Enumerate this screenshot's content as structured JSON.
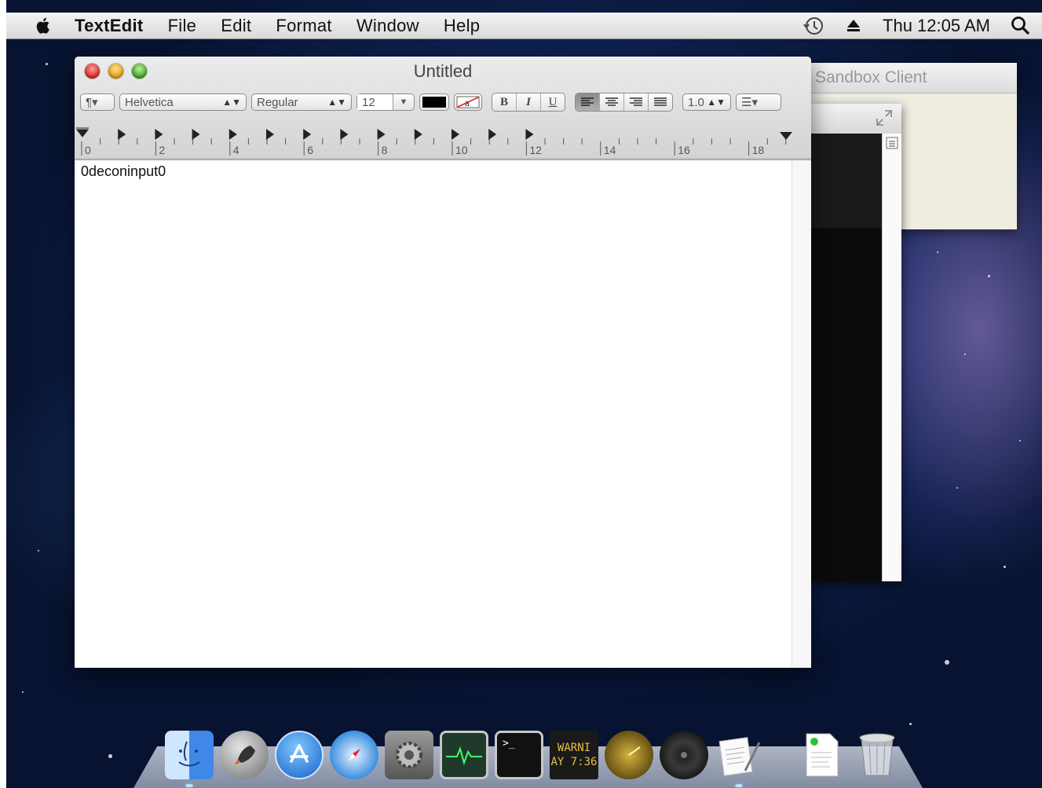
{
  "menubar": {
    "app_name": "TextEdit",
    "items": [
      "File",
      "Edit",
      "Format",
      "Window",
      "Help"
    ],
    "clock": "Thu 12:05 AM"
  },
  "textedit": {
    "title": "Untitled",
    "toolbar": {
      "paragraph": "¶▾",
      "font_family": "Helvetica",
      "font_style": "Regular",
      "font_size": "12",
      "bold": "B",
      "italic": "I",
      "underline": "U",
      "line_spacing": "1.0",
      "list": "☰▾"
    },
    "ruler_labels": [
      "0",
      "2",
      "4",
      "6",
      "8",
      "10",
      "12",
      "14",
      "16",
      "18"
    ],
    "document_text": "0deconinput0"
  },
  "background_window": {
    "title": "Sandbox Client"
  },
  "dock": {
    "items": [
      {
        "name": "finder-icon"
      },
      {
        "name": "launchpad-icon"
      },
      {
        "name": "app-store-icon"
      },
      {
        "name": "safari-icon"
      },
      {
        "name": "system-preferences-icon"
      },
      {
        "name": "activity-monitor-icon"
      },
      {
        "name": "terminal-icon"
      },
      {
        "name": "console-icon",
        "text_line1": "WARNI",
        "text_line2": "AY 7:36"
      },
      {
        "name": "radar-icon"
      },
      {
        "name": "dvd-player-icon"
      },
      {
        "name": "textedit-icon"
      },
      {
        "name": "document-icon"
      },
      {
        "name": "trash-icon"
      }
    ]
  }
}
